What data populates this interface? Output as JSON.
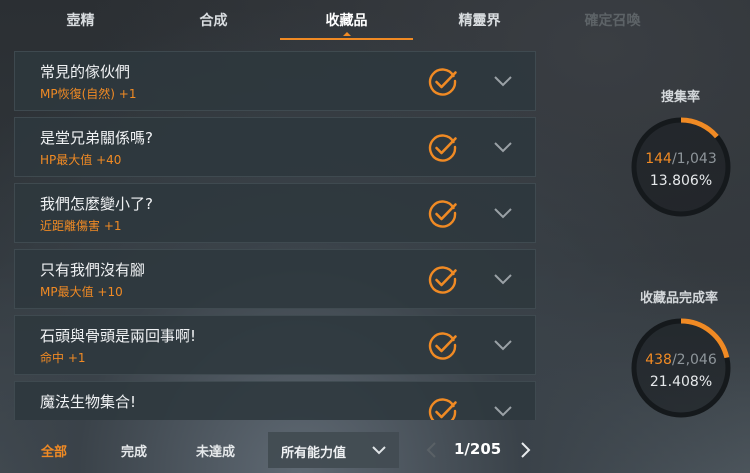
{
  "tabs": [
    {
      "label": "壺精",
      "state": "normal"
    },
    {
      "label": "合成",
      "state": "normal"
    },
    {
      "label": "收藏品",
      "state": "active"
    },
    {
      "label": "精靈界",
      "state": "normal"
    },
    {
      "label": "確定召喚",
      "state": "disabled"
    }
  ],
  "collections": [
    {
      "title": "常見的傢伙們",
      "bonus": "MP恢復(自然)  +1"
    },
    {
      "title": "是堂兄弟關係嗎?",
      "bonus": "HP最大值  +40"
    },
    {
      "title": "我們怎麼變小了?",
      "bonus": "近距離傷害  +1"
    },
    {
      "title": "只有我們沒有腳",
      "bonus": "MP最大值  +10"
    },
    {
      "title": "石頭與骨頭是兩回事啊!",
      "bonus": "命中  +1"
    },
    {
      "title": "魔法生物集合!",
      "bonus": ""
    }
  ],
  "stats": {
    "gather": {
      "label": "搜集率",
      "current": "144",
      "total": "1,043",
      "percent_text": "13.806%",
      "percent": 13.806
    },
    "completion": {
      "label": "收藏品完成率",
      "current": "438",
      "total": "2,046",
      "percent_text": "21.408%",
      "percent": 21.408
    }
  },
  "filters": {
    "all": "全部",
    "done": "完成",
    "undone": "未達成"
  },
  "dropdown": {
    "label": "所有能力值"
  },
  "pager": {
    "text": "1/205"
  },
  "colors": {
    "accent": "#f08a24",
    "ring_track": "#15191c"
  },
  "icons": {
    "check": "check-circle-icon",
    "expand": "chevron-down-icon",
    "prev": "chevron-left-icon",
    "next": "chevron-right-icon"
  }
}
